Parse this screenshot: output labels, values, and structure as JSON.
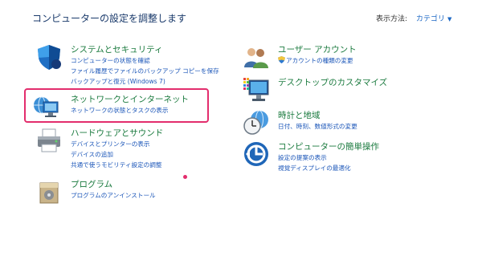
{
  "header": {
    "title": "コンピューターの設定を調整します",
    "view_label": "表示方法:",
    "view_value": "カテゴリ"
  },
  "categories": {
    "system": {
      "title": "システムとセキュリティ",
      "links": [
        "コンピューターの状態を確認",
        "ファイル履歴でファイルのバックアップ コピーを保存",
        "バックアップと復元 (Windows 7)"
      ]
    },
    "network": {
      "title": "ネットワークとインターネット",
      "links": [
        "ネットワークの状態とタスクの表示"
      ]
    },
    "hardware": {
      "title": "ハードウェアとサウンド",
      "links": [
        "デバイスとプリンターの表示",
        "デバイスの追加",
        "共通で使うモビリティ設定の調整"
      ]
    },
    "programs": {
      "title": "プログラム",
      "links": [
        "プログラムのアンインストール"
      ]
    },
    "user": {
      "title": "ユーザー アカウント",
      "links": [
        "アカウントの種類の変更"
      ]
    },
    "appearance": {
      "title": "デスクトップのカスタマイズ",
      "links": []
    },
    "clock": {
      "title": "時計と地域",
      "links": [
        "日付、時刻、数値形式の変更"
      ]
    },
    "ease": {
      "title": "コンピューターの簡単操作",
      "links": [
        "設定の提案の表示",
        "視覚ディスプレイの最適化"
      ]
    }
  },
  "colors": {
    "title_green": "#1a7a3e",
    "link_blue": "#1a55b8",
    "highlight": "#e32d6d"
  },
  "icons": {
    "system": "shield-icon",
    "network": "globe-monitor-icon",
    "hardware": "printer-icon",
    "programs": "program-box-icon",
    "user": "users-icon",
    "appearance": "desktop-monitor-icon",
    "clock": "clock-globe-icon",
    "ease": "ease-of-access-icon"
  }
}
